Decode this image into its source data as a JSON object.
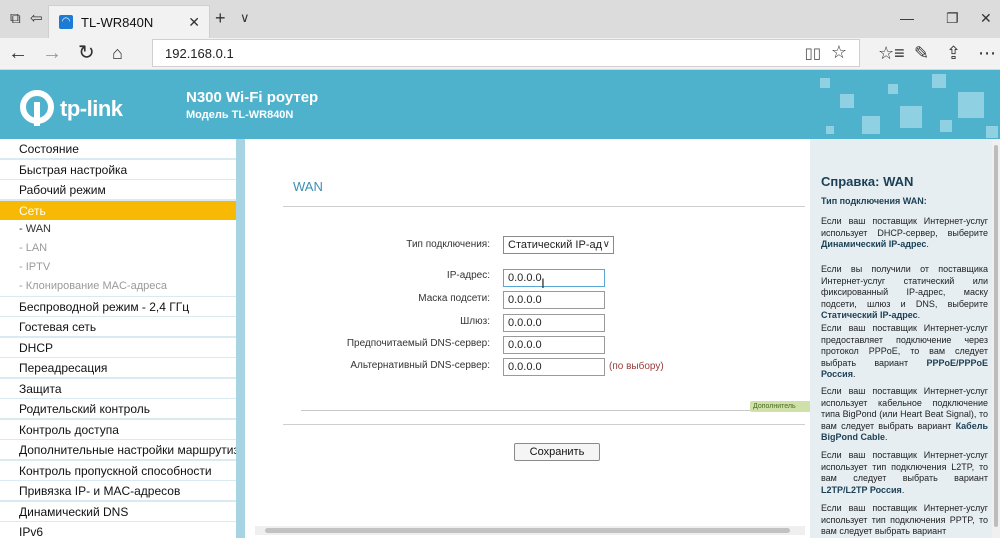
{
  "browser": {
    "tab_title": "TL-WR840N",
    "url": "192.168.0.1",
    "icons": {
      "set_aside": "set-tabs-aside-icon",
      "tab_preview": "tab-preview-icon",
      "tab_close": "close-icon",
      "new_tab": "plus-icon",
      "tab_menu": "chevron-down-icon",
      "back": "arrow-left-icon",
      "forward": "arrow-right-icon",
      "refresh": "refresh-icon",
      "home": "home-icon",
      "reading_view": "book-icon",
      "favorite": "star-icon",
      "favorites_hub": "favorites-hub-icon",
      "notes": "pen-icon",
      "share": "share-icon",
      "more": "more-icon"
    }
  },
  "header": {
    "brand": "tp-link",
    "product": "N300 Wi-Fi роутер",
    "model": "Модель TL-WR840N"
  },
  "sidebar": {
    "items": [
      {
        "label": "Состояние"
      },
      {
        "label": "Быстрая настройка"
      },
      {
        "label": "Рабочий режим"
      },
      {
        "label": "Сеть",
        "active": true
      },
      {
        "label": "- WAN",
        "sub": true,
        "current": true
      },
      {
        "label": "- LAN",
        "sub": true
      },
      {
        "label": "- IPTV",
        "sub": true
      },
      {
        "label": "- Клонирование MAC-адреса",
        "sub": true
      },
      {
        "label": "Беспроводной режим - 2,4 ГГц"
      },
      {
        "label": "Гостевая сеть"
      },
      {
        "label": "DHCP"
      },
      {
        "label": "Переадресация"
      },
      {
        "label": "Защита"
      },
      {
        "label": "Родительский контроль"
      },
      {
        "label": "Контроль доступа"
      },
      {
        "label": "Дополнительные настройки маршрутизации"
      },
      {
        "label": "Контроль пропускной способности"
      },
      {
        "label": "Привязка IP- и MAC-адресов"
      },
      {
        "label": "Динамический DNS"
      },
      {
        "label": "IPv6"
      }
    ]
  },
  "form": {
    "title": "WAN",
    "connection_type_label": "Тип подключения:",
    "connection_type_value": "Статический IP-ад",
    "fields": [
      {
        "label": "IP-адрес:",
        "value": "0.0.0.0"
      },
      {
        "label": "Маска подсети:",
        "value": "0.0.0.0"
      },
      {
        "label": "Шлюз:",
        "value": "0.0.0.0"
      },
      {
        "label": "Предпочитаемый DNS-сервер:",
        "value": "0.0.0.0"
      },
      {
        "label": "Альтернативный DNS-сервер:",
        "value": "0.0.0.0"
      }
    ],
    "optional_note": "(по выбору)",
    "advanced_label": "Дополнитель",
    "save_label": "Сохранить"
  },
  "help": {
    "title": "Справка: WAN",
    "subtitle": "Тип подключения WAN:",
    "paragraphs": [
      {
        "text": "Если ваш поставщик Интернет-услуг использует DHCP-сервер, выберите ",
        "bold": "Динамический IP-адрес",
        "end": "."
      },
      {
        "text": "Если вы получили от поставщика Интернет-услуг статический или фиксированный IP-адрес, маску подсети, шлюз и DNS, выберите ",
        "bold": "Статический IP-адрес",
        "end": "."
      },
      {
        "text": "Если ваш поставщик Интернет-услуг предоставляет подключение через протокол PPPoE, то вам следует выбрать вариант ",
        "bold": "PPPoE/PPPoE Россия",
        "end": "."
      },
      {
        "text": "Если ваш поставщик Интернет-услуг использует кабельное подключение типа BigPond (или Heart Beat Signal), то вам следует выбрать вариант ",
        "bold": "Кабель BigPond Cable",
        "end": "."
      },
      {
        "text": "Если ваш поставщик Интернет-услуг использует тип подключения L2TP, то вам следует выбрать вариант ",
        "bold": "L2TP/L2TP Россия",
        "end": "."
      },
      {
        "text": "Если ваш поставщик Интернет-услуг использует тип подключения PPTP, то вам следует выбрать вариант",
        "bold": "",
        "end": ""
      }
    ]
  },
  "colors": {
    "header_bg": "#4eb2cd",
    "active_menu": "#f7b903",
    "title_blue": "#3d8fb4"
  }
}
